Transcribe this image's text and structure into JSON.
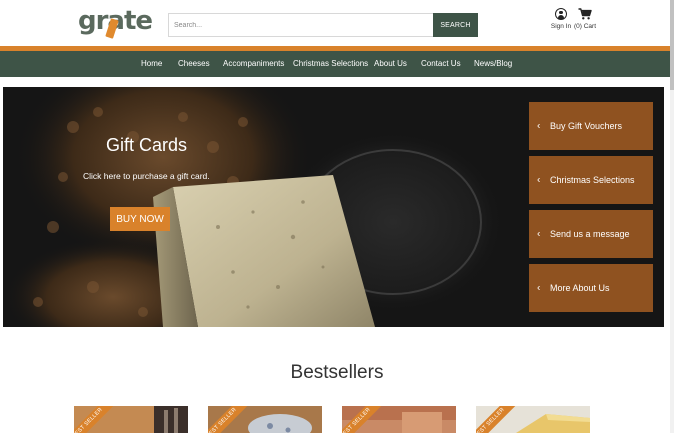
{
  "brand": {
    "logo_text": "grate"
  },
  "search": {
    "placeholder": "Search...",
    "button_label": "SEARCH"
  },
  "account": {
    "signin_label": "Sign In",
    "cart_label": "(0) Cart"
  },
  "nav": {
    "items": [
      "Home",
      "Cheeses",
      "Accompaniments",
      "Christmas Selections",
      "About Us",
      "Contact Us",
      "News/Blog"
    ]
  },
  "hero": {
    "title": "Gift Cards",
    "subtitle": "Click here to purchase a gift card.",
    "cta_label": "BUY NOW",
    "side_buttons": [
      "Buy Gift Vouchers",
      "Christmas Selections",
      "Send us a message",
      "More About Us"
    ]
  },
  "bestsellers": {
    "title": "Bestsellers",
    "ribbon_label": "BEST SELLER",
    "product_count_visible": 4
  },
  "colors": {
    "brand_green": "#3e5447",
    "brand_orange": "#d9822b",
    "side_button_brown": "#8f5220"
  },
  "icons": {
    "account": "user-circle-icon",
    "cart": "shopping-cart-icon",
    "side_chevron": "chevron-left-icon"
  }
}
